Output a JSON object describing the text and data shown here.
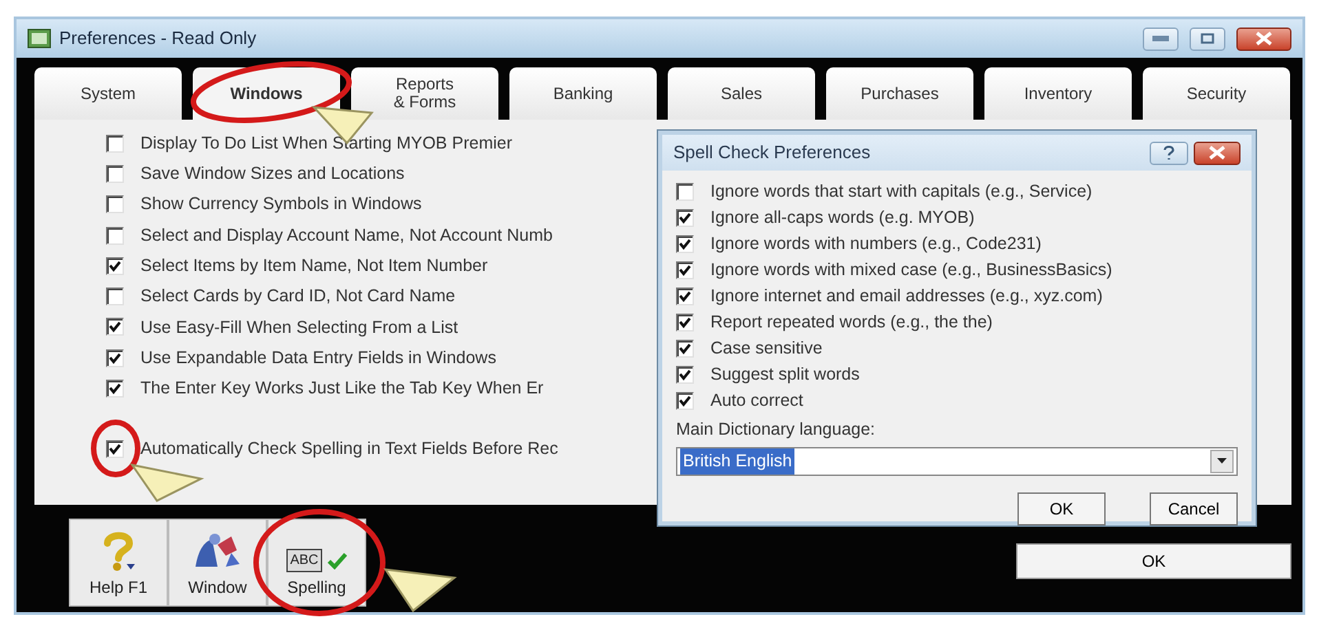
{
  "window": {
    "title": "Preferences - Read Only"
  },
  "tabs": [
    {
      "label": "System",
      "selected": false
    },
    {
      "label": "Windows",
      "selected": true
    },
    {
      "label": "Reports\n& Forms",
      "selected": false
    },
    {
      "label": "Banking",
      "selected": false
    },
    {
      "label": "Sales",
      "selected": false
    },
    {
      "label": "Purchases",
      "selected": false
    },
    {
      "label": "Inventory",
      "selected": false
    },
    {
      "label": "Security",
      "selected": false
    }
  ],
  "options": [
    {
      "label": "Display To Do List When Starting MYOB Premier",
      "checked": false
    },
    {
      "label": "Save Window Sizes and Locations",
      "checked": false
    },
    {
      "label": "Show Currency Symbols in Windows",
      "checked": false
    },
    {
      "label": "Select and Display Account Name, Not Account Numb",
      "checked": false
    },
    {
      "label": "Select Items by Item Name, Not Item Number",
      "checked": true
    },
    {
      "label": "Select Cards by Card ID, Not Card Name",
      "checked": false
    },
    {
      "label": "Use Easy-Fill When Selecting From a List",
      "checked": true
    },
    {
      "label": "Use Expandable Data Entry Fields in Windows",
      "checked": true
    },
    {
      "label": "The Enter Key Works Just Like the Tab Key When Er",
      "checked": true
    },
    {
      "label": "Automatically Check Spelling in Text Fields Before Rec",
      "checked": true,
      "gap_before": true
    }
  ],
  "toolbar": [
    {
      "kind": "help",
      "label": "Help F1"
    },
    {
      "kind": "window",
      "label": "Window"
    },
    {
      "kind": "spelling",
      "label": "Spelling",
      "icon_text": "ABC"
    }
  ],
  "ok_button": "OK",
  "spell_dialog": {
    "title": "Spell Check Preferences",
    "options": [
      {
        "label": "Ignore words that start with capitals (e.g., Service)",
        "checked": false
      },
      {
        "label": "Ignore all-caps words (e.g. MYOB)",
        "checked": true
      },
      {
        "label": "Ignore words with numbers (e.g., Code231)",
        "checked": true
      },
      {
        "label": "Ignore words with mixed case (e.g., BusinessBasics)",
        "checked": true
      },
      {
        "label": "Ignore internet and email addresses (e.g., xyz.com)",
        "checked": true
      },
      {
        "label": "Report repeated words (e.g., the the)",
        "checked": true
      },
      {
        "label": "Case sensitive",
        "checked": true
      },
      {
        "label": "Suggest split words",
        "checked": true
      },
      {
        "label": "Auto correct",
        "checked": true
      }
    ],
    "language_label": "Main Dictionary language:",
    "language": "British English",
    "buttons": [
      "OK",
      "Cancel"
    ]
  }
}
